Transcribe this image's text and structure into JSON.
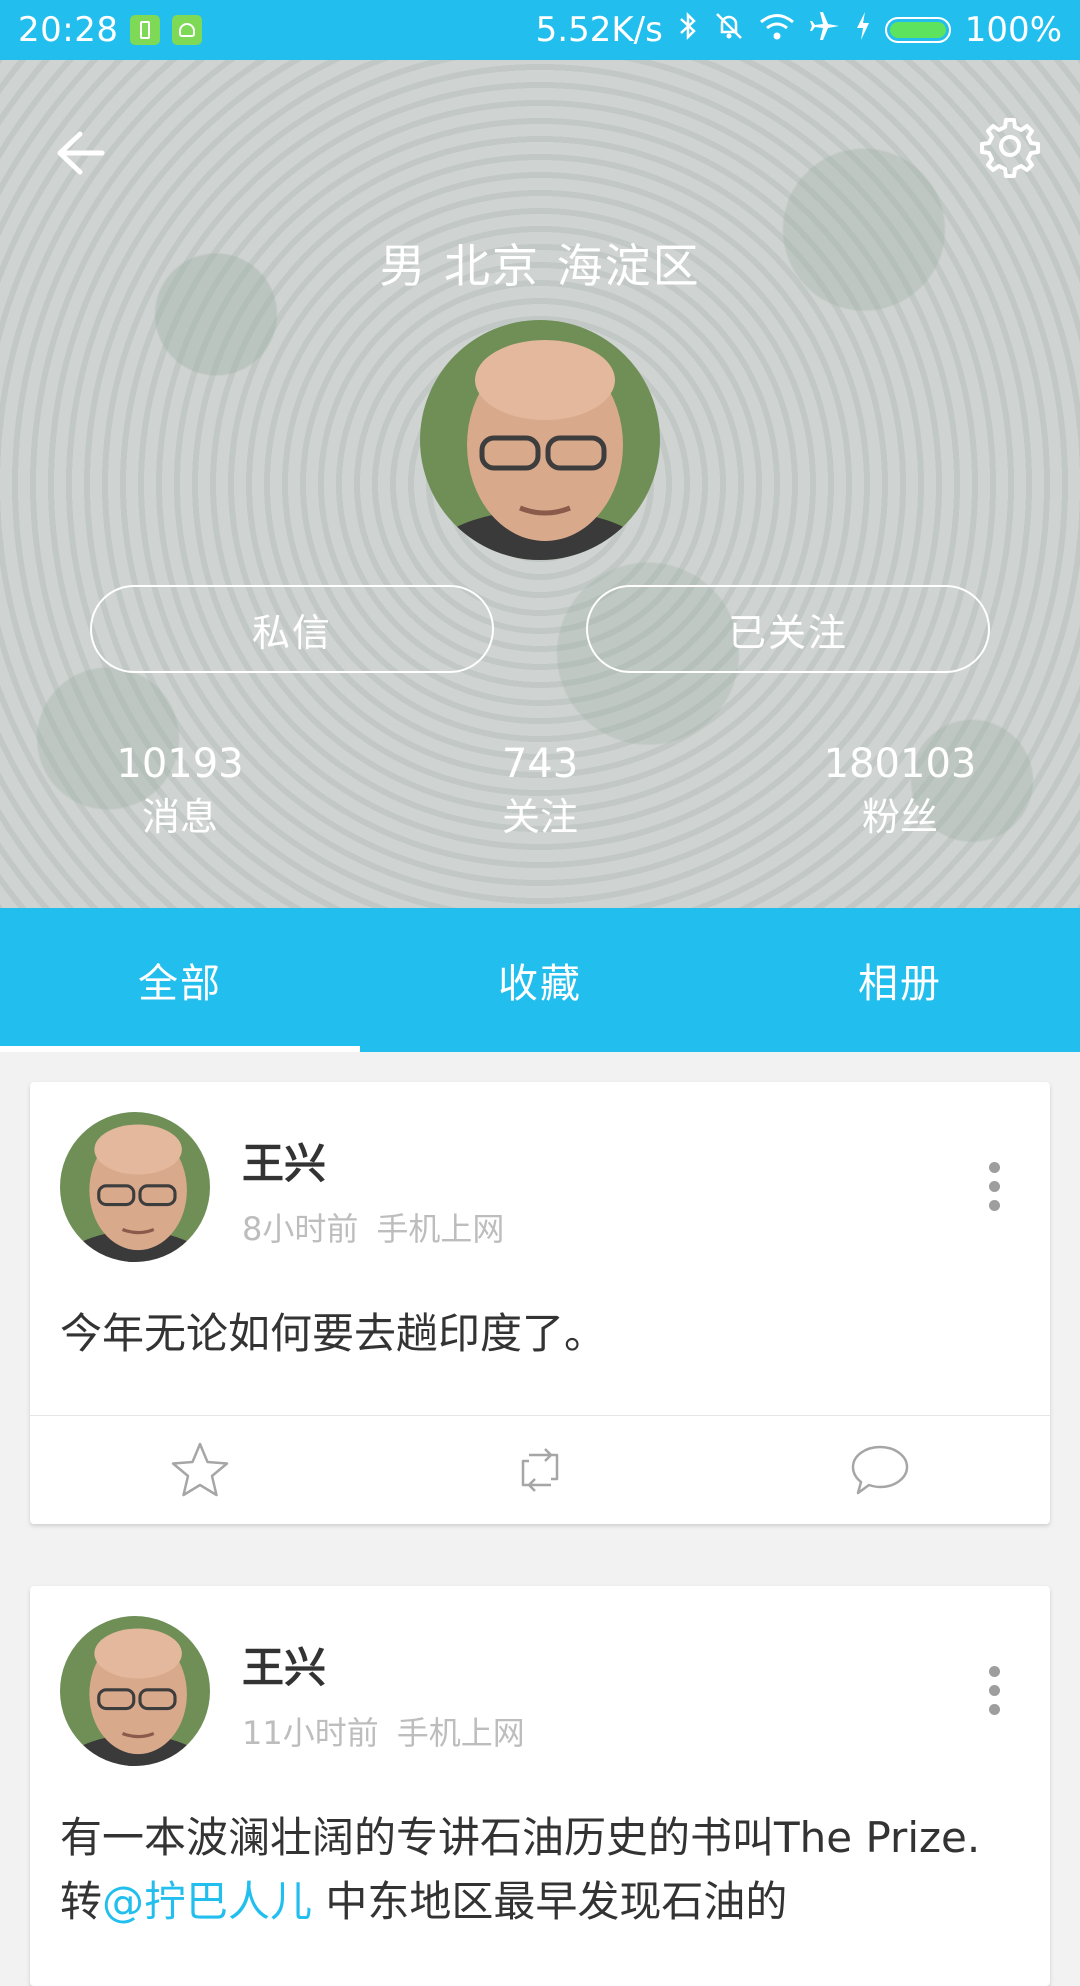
{
  "status_bar": {
    "time": "20:28",
    "net_speed": "5.52K/s",
    "battery_percent": "100%",
    "battery_level": 1.0,
    "icons": [
      "battery-app-icon",
      "android-app-icon",
      "bluetooth-icon",
      "mute-icon",
      "wifi-icon",
      "airplane-icon",
      "charging-icon"
    ]
  },
  "header": {
    "location": "男 北京 海淀区",
    "buttons": {
      "message": "私信",
      "follow": "已关注"
    },
    "stats": [
      {
        "value": "10193",
        "label": "消息"
      },
      {
        "value": "743",
        "label": "关注"
      },
      {
        "value": "180103",
        "label": "粉丝"
      }
    ]
  },
  "tabs": [
    {
      "label": "全部",
      "active": true
    },
    {
      "label": "收藏",
      "active": false
    },
    {
      "label": "相册",
      "active": false
    }
  ],
  "posts": [
    {
      "author": "王兴",
      "time": "8小时前",
      "source": "手机上网",
      "text": "今年无论如何要去趟印度了。"
    },
    {
      "author": "王兴",
      "time": "11小时前",
      "source": "手机上网",
      "text_before": "有一本波澜壮阔的专讲石油历史的书叫The Prize.转",
      "mention": "@拧巴人儿",
      "text_after": " 中东地区最早发现石油的"
    }
  ],
  "colors": {
    "accent": "#22bfee",
    "status_bar": "#22bfee",
    "muted_text": "#bdbdbd"
  }
}
